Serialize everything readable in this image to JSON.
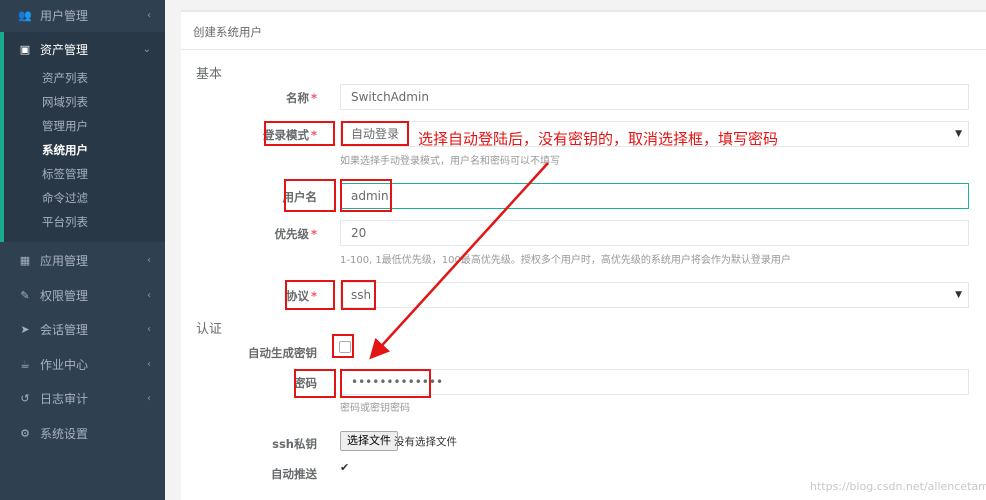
{
  "sidebar": {
    "items": [
      {
        "label": "用户管理",
        "icon": "users-icon"
      },
      {
        "label": "资产管理",
        "icon": "inbox-icon"
      },
      {
        "label": "应用管理",
        "icon": "grid-icon"
      },
      {
        "label": "权限管理",
        "icon": "edit-icon"
      },
      {
        "label": "会话管理",
        "icon": "rocket-icon"
      },
      {
        "label": "作业中心",
        "icon": "coffee-icon"
      },
      {
        "label": "日志审计",
        "icon": "history-icon"
      },
      {
        "label": "系统设置",
        "icon": "gears-icon"
      }
    ],
    "asset_sub": [
      "资产列表",
      "网域列表",
      "管理用户",
      "系统用户",
      "标签管理",
      "命令过滤",
      "平台列表"
    ]
  },
  "panel": {
    "title": "创建系统用户"
  },
  "sections": {
    "basic": "基本",
    "auth": "认证"
  },
  "form": {
    "name": {
      "label": "名称",
      "value": "SwitchAdmin"
    },
    "login_mode": {
      "label": "登录模式",
      "value": "自动登录",
      "help": "如果选择手动登录模式，用户名和密码可以不填写"
    },
    "username": {
      "label": "用户名",
      "value": "admin"
    },
    "priority": {
      "label": "优先级",
      "value": "20",
      "help": "1-100, 1最低优先级，100最高优先级。授权多个用户时，高优先级的系统用户将会作为默认登录用户"
    },
    "protocol": {
      "label": "协议",
      "value": "ssh"
    },
    "auto_key": {
      "label": "自动生成密钥"
    },
    "password": {
      "label": "密码",
      "value": "•••••••••••••",
      "help": "密码或密钥密码"
    },
    "ssh_key": {
      "label": "ssh私钥",
      "button": "选择文件",
      "status": "没有选择文件"
    },
    "auto_push": {
      "label": "自动推送"
    }
  },
  "annotation": "选择自动登陆后，没有密钥的，取消选择框，填写密码",
  "watermark": "https://blog.csdn.net/allencetam",
  "colors": {
    "annotation": "#e21414",
    "accent": "#1ab394",
    "sidebar": "#2f4050"
  }
}
